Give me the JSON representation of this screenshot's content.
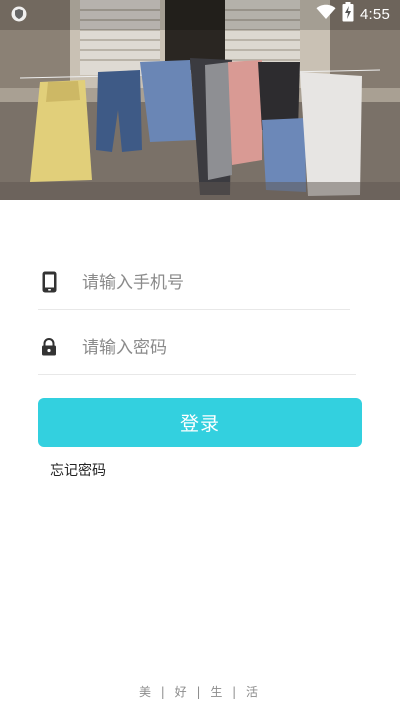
{
  "status_bar": {
    "time": "4:55",
    "icons": [
      "shield-icon",
      "wifi-icon",
      "battery-charging-icon"
    ]
  },
  "hero": {
    "image": "clothesline-photo"
  },
  "login_form": {
    "phone_placeholder": "请输入手机号",
    "phone_value": "",
    "password_placeholder": "请输入密码",
    "password_value": "",
    "login_label": "登录",
    "forgot_password_label": "忘记密码",
    "icons": [
      "phone-icon",
      "lock-icon"
    ]
  },
  "footer": {
    "slogan": "美 | 好 | 生 | 活"
  },
  "colors": {
    "accent": "#33d0df",
    "placeholder": "#8a8a8a",
    "divider": "#e8e8e8"
  }
}
